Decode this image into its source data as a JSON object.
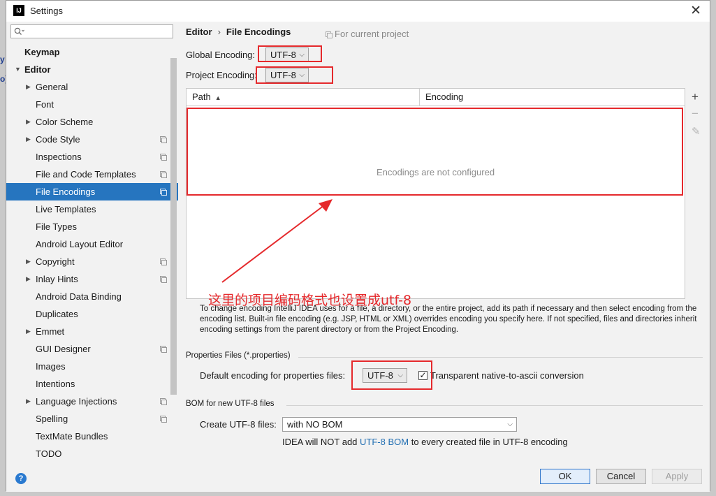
{
  "window": {
    "title": "Settings",
    "app_icon_text": "IJ",
    "close_glyph": "✕"
  },
  "search": {
    "placeholder": ""
  },
  "sidebar": {
    "items": [
      {
        "label": "Keymap",
        "level": 0,
        "expandable": false,
        "bold": true
      },
      {
        "label": "Editor",
        "level": 0,
        "expandable": true,
        "expanded": true,
        "bold": true
      },
      {
        "label": "General",
        "level": 1,
        "expandable": true
      },
      {
        "label": "Font",
        "level": 1,
        "expandable": false
      },
      {
        "label": "Color Scheme",
        "level": 1,
        "expandable": true
      },
      {
        "label": "Code Style",
        "level": 1,
        "expandable": true,
        "project_icon": true
      },
      {
        "label": "Inspections",
        "level": 1,
        "expandable": false,
        "project_icon": true
      },
      {
        "label": "File and Code Templates",
        "level": 1,
        "expandable": false,
        "project_icon": true
      },
      {
        "label": "File Encodings",
        "level": 1,
        "expandable": false,
        "project_icon": true,
        "selected": true
      },
      {
        "label": "Live Templates",
        "level": 1,
        "expandable": false
      },
      {
        "label": "File Types",
        "level": 1,
        "expandable": false
      },
      {
        "label": "Android Layout Editor",
        "level": 1,
        "expandable": false
      },
      {
        "label": "Copyright",
        "level": 1,
        "expandable": true,
        "project_icon": true
      },
      {
        "label": "Inlay Hints",
        "level": 1,
        "expandable": true,
        "project_icon": true
      },
      {
        "label": "Android Data Binding",
        "level": 1,
        "expandable": false
      },
      {
        "label": "Duplicates",
        "level": 1,
        "expandable": false
      },
      {
        "label": "Emmet",
        "level": 1,
        "expandable": true
      },
      {
        "label": "GUI Designer",
        "level": 1,
        "expandable": false,
        "project_icon": true
      },
      {
        "label": "Images",
        "level": 1,
        "expandable": false
      },
      {
        "label": "Intentions",
        "level": 1,
        "expandable": false
      },
      {
        "label": "Language Injections",
        "level": 1,
        "expandable": true,
        "project_icon": true
      },
      {
        "label": "Spelling",
        "level": 1,
        "expandable": false,
        "project_icon": true
      },
      {
        "label": "TextMate Bundles",
        "level": 1,
        "expandable": false
      },
      {
        "label": "TODO",
        "level": 1,
        "expandable": false
      }
    ]
  },
  "breadcrumb": {
    "parent": "Editor",
    "separator": "›",
    "current": "File Encodings"
  },
  "for_current_project": "For current project",
  "global_encoding": {
    "label": "Global Encoding:",
    "value": "UTF-8"
  },
  "project_encoding": {
    "label": "Project Encoding:",
    "value": "UTF-8"
  },
  "table": {
    "columns": [
      "Path",
      "Encoding"
    ],
    "sort_indicator": "▲",
    "empty_text": "Encodings are not configured",
    "tools": {
      "add": "+",
      "remove": "−",
      "edit": "✎"
    }
  },
  "description": "To change encoding IntelliJ IDEA uses for a file, a directory, or the entire project, add its path if necessary and then select encoding from the encoding list. Built-in file encoding (e.g. JSP, HTML or XML) overrides encoding you specify here. If not specified, files and directories inherit encoding settings from the parent directory or from the Project Encoding.",
  "properties": {
    "section_title": "Properties Files (*.properties)",
    "default_label": "Default encoding for properties files:",
    "default_value": "UTF-8",
    "native_to_ascii_label": "Transparent native-to-ascii conversion",
    "native_to_ascii_checked": true,
    "check_glyph": "✓"
  },
  "bom": {
    "section_title": "BOM for new UTF-8 files",
    "create_label": "Create UTF-8 files:",
    "create_value": "with NO BOM",
    "note_prefix": "IDEA will NOT add ",
    "note_link": "UTF-8 BOM",
    "note_suffix": " to every created file in UTF-8 encoding"
  },
  "annotation": {
    "text": "这里的项目编码格式也设置成utf-8",
    "color": "#e5292c"
  },
  "footer": {
    "help": "?",
    "ok": "OK",
    "cancel": "Cancel",
    "apply": "Apply"
  },
  "behind_window": {
    "fragment_1": "y",
    "fragment_2": "o]"
  },
  "colors": {
    "selection": "#2675bf",
    "link": "#2470b3",
    "annotation_red": "#e5292c"
  },
  "icons": {
    "chevron": "chevron-down-icon",
    "arrow_right": "▶",
    "arrow_down": "▼",
    "chevron_glyph": "⌵"
  }
}
